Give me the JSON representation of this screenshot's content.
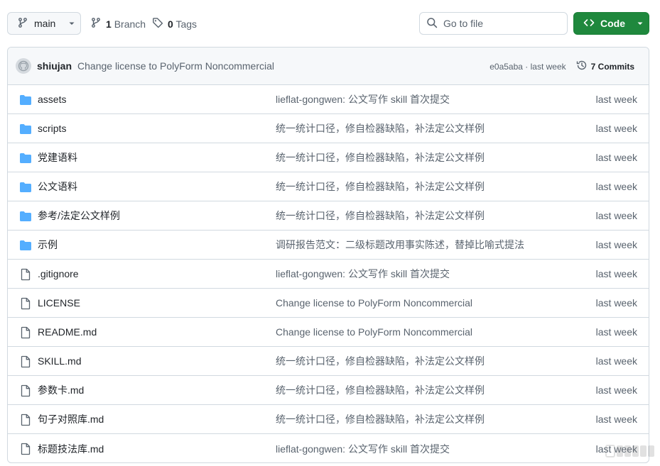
{
  "toolbar": {
    "branch_label": "main",
    "branches_count": "1",
    "branches_label": "Branch",
    "tags_count": "0",
    "tags_label": "Tags",
    "goto_placeholder": "Go to file",
    "code_label": "Code"
  },
  "latest_commit": {
    "author": "shiujan",
    "message": "Change license to PolyForm Noncommercial",
    "hash_time": "e0a5aba · last week",
    "commits_label": "7 Commits"
  },
  "files": [
    {
      "type": "folder",
      "name": "assets",
      "message": "lieflat-gongwen: 公文写作 skill 首次提交",
      "time": "last week"
    },
    {
      "type": "folder",
      "name": "scripts",
      "message": "统一统计口径，修自检器缺陷，补法定公文样例",
      "time": "last week"
    },
    {
      "type": "folder",
      "name": "党建语料",
      "message": "统一统计口径，修自检器缺陷，补法定公文样例",
      "time": "last week"
    },
    {
      "type": "folder",
      "name": "公文语料",
      "message": "统一统计口径，修自检器缺陷，补法定公文样例",
      "time": "last week"
    },
    {
      "type": "folder",
      "name": "参考/法定公文样例",
      "message": "统一统计口径，修自检器缺陷，补法定公文样例",
      "time": "last week"
    },
    {
      "type": "folder",
      "name": "示例",
      "message": "调研报告范文：二级标题改用事实陈述，替掉比喻式提法",
      "time": "last week"
    },
    {
      "type": "file",
      "name": ".gitignore",
      "message": "lieflat-gongwen: 公文写作 skill 首次提交",
      "time": "last week"
    },
    {
      "type": "file",
      "name": "LICENSE",
      "message": "Change license to PolyForm Noncommercial",
      "time": "last week"
    },
    {
      "type": "file",
      "name": "README.md",
      "message": "Change license to PolyForm Noncommercial",
      "time": "last week"
    },
    {
      "type": "file",
      "name": "SKILL.md",
      "message": "统一统计口径，修自检器缺陷，补法定公文样例",
      "time": "last week"
    },
    {
      "type": "file",
      "name": "参数卡.md",
      "message": "统一统计口径，修自检器缺陷，补法定公文样例",
      "time": "last week"
    },
    {
      "type": "file",
      "name": "句子对照库.md",
      "message": "统一统计口径，修自检器缺陷，补法定公文样例",
      "time": "last week"
    },
    {
      "type": "file",
      "name": "标题技法库.md",
      "message": "lieflat-gongwen: 公文写作 skill 首次提交",
      "time": "last week"
    }
  ],
  "colors": {
    "accent_green": "#1f883d",
    "folder_blue": "#54aeff",
    "border": "#d1d9e0",
    "muted_text": "#59636e"
  },
  "icons": {
    "branch": "git-branch-icon",
    "tag": "tag-icon",
    "search": "search-icon",
    "code": "code-icon",
    "history": "history-icon",
    "folder": "folder-icon",
    "file": "file-icon"
  }
}
